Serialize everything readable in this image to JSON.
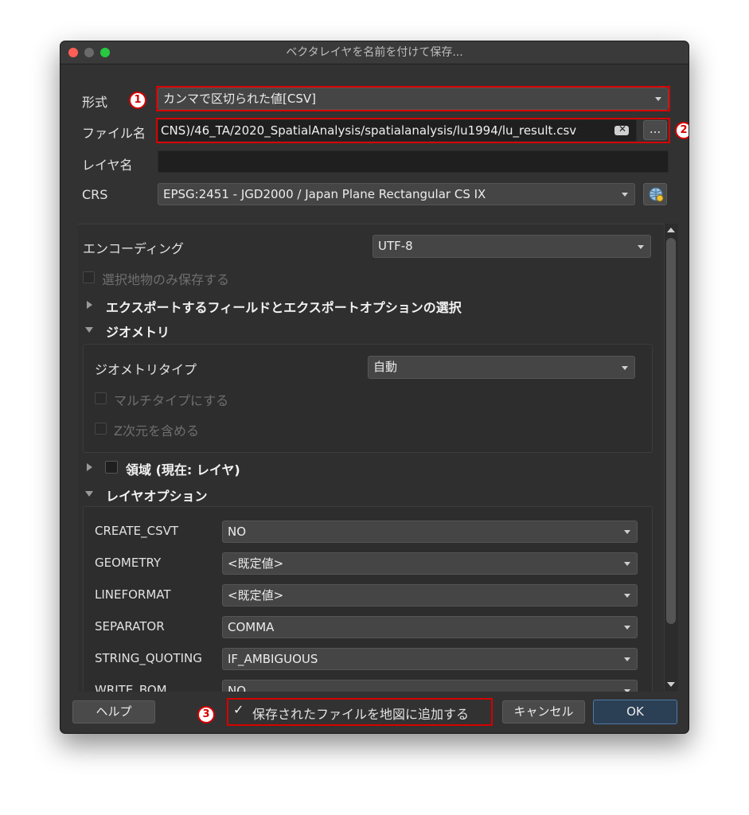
{
  "window": {
    "title": "ベクタレイヤを名前を付けて保存..."
  },
  "form": {
    "format_label": "形式",
    "format_value": "カンマで区切られた値[CSV]",
    "filename_label": "ファイル名",
    "filename_value": "CNS)/46_TA/2020_SpatialAnalysis/spatialanalysis/lu1994/lu_result.csv",
    "browse_label": "...",
    "layername_label": "レイヤ名",
    "layername_value": "",
    "crs_label": "CRS",
    "crs_value": "EPSG:2451 - JGD2000 / Japan Plane Rectangular CS IX"
  },
  "markers": {
    "m1": "1",
    "m2": "2",
    "m3": "3"
  },
  "options": {
    "encoding_label": "エンコーディング",
    "encoding_value": "UTF-8",
    "selected_only_label": "選択地物のみ保存する",
    "fields_section": "エクスポートするフィールドとエクスポートオプションの選択",
    "geometry_section": "ジオメトリ",
    "geometry_type_label": "ジオメトリタイプ",
    "geometry_type_value": "自動",
    "multitype_label": "マルチタイプにする",
    "z_label": "Z次元を含める",
    "extent_section": "領域 (現在: レイヤ)",
    "layer_options_section": "レイヤオプション",
    "layer_options": [
      {
        "key": "CREATE_CSVT",
        "value": "NO"
      },
      {
        "key": "GEOMETRY",
        "value": "<既定値>"
      },
      {
        "key": "LINEFORMAT",
        "value": "<既定値>"
      },
      {
        "key": "SEPARATOR",
        "value": "COMMA"
      },
      {
        "key": "STRING_QUOTING",
        "value": "IF_AMBIGUOUS"
      },
      {
        "key": "WRITE_BOM",
        "value": "NO"
      }
    ]
  },
  "footer": {
    "help_label": "ヘルプ",
    "add_to_map_label": "保存されたファイルを地図に追加する",
    "add_to_map_checked": true,
    "cancel_label": "キャンセル",
    "ok_label": "OK"
  },
  "colors": {
    "highlight": "#d60000",
    "ok_button": "#2b3f55"
  }
}
